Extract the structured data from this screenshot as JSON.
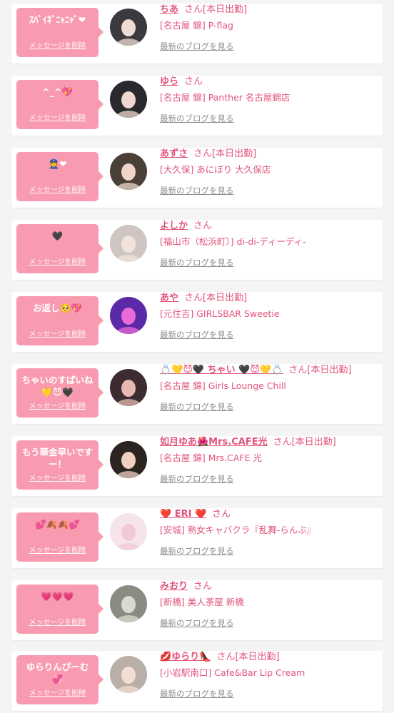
{
  "delete_label": "メッセージを削除",
  "san_label": "さん",
  "blog_label": "最新のブログを見る",
  "colors": {
    "accent": "#e2547a",
    "bubble": "#f89bb0",
    "background": "#f4f4f5",
    "link_gray": "#8f8f8f"
  },
  "items": [
    {
      "message": "ｽﾊﾞｲﾈﾞﾆｬﾆｬﾞ❤",
      "name": "ちあ",
      "status": "[本日出勤]",
      "shop": "[名古屋 錦] P-flag",
      "avatar_colors": [
        "#3a3a40",
        "#f1dcd4"
      ]
    },
    {
      "message": "^_^💖",
      "name": "ゆら",
      "status": "",
      "shop": "[名古屋 錦] Panther 名古屋錦店",
      "avatar_colors": [
        "#2a2a2e",
        "#f0d8d0"
      ]
    },
    {
      "message": "👮❤",
      "name": "あずさ",
      "status": "[本日出勤]",
      "shop": "[大久保] あにぼり 大久保店",
      "avatar_colors": [
        "#4a4038",
        "#eed5c8"
      ]
    },
    {
      "message": "🖤",
      "name": "よしか",
      "status": "",
      "shop": "[福山市（松浜町）] di-di-ディーディ-",
      "avatar_colors": [
        "#cfc6c4",
        "#f3e3dd"
      ]
    },
    {
      "message": "お返し🥺💖",
      "name": "あや",
      "status": "[本日出勤]",
      "shop": "[元住吉] GIRLSBAR Sweetie",
      "avatar_colors": [
        "#5a2aa8",
        "#e86bd8"
      ]
    },
    {
      "message": "ちゃいのすぱいね\n💛😈🖤",
      "name": "💍💛😈🖤 ちゃい 🖤😈💛💍",
      "status": "[本日出勤]",
      "shop": "[名古屋 錦] Girls Lounge Chill",
      "avatar_colors": [
        "#3c2c30",
        "#e7b9b2"
      ]
    },
    {
      "message": "もう華金早いです\nー！",
      "name": "如月ゆあ🌺Mrs.CAFE光",
      "status": "[本日出勤]",
      "shop": "[名古屋 錦] Mrs.CAFE 光",
      "avatar_colors": [
        "#2b2420",
        "#efcfc0"
      ]
    },
    {
      "message": "💕🍂🍂💕",
      "name": "❤️ ERI ❤️",
      "status": "",
      "shop": "[安城] 熟女キャバクラ『乱舞-らんぶ』",
      "avatar_colors": [
        "#f6e4ec",
        "#f2c9d8"
      ]
    },
    {
      "message": "💗💗💗",
      "name": "みおり",
      "status": "",
      "shop": "[新橋] 美人茶屋 新橋",
      "avatar_colors": [
        "#8a8c84",
        "#d9dbd0"
      ]
    },
    {
      "message": "ゆらりんぴーむ💞",
      "name": "💋ゆらり👠",
      "status": "[本日出勤]",
      "shop": "[小岩駅南口] Cafe&Bar Lip Cream",
      "avatar_colors": [
        "#b8b0a8",
        "#f4ddd2"
      ]
    }
  ]
}
